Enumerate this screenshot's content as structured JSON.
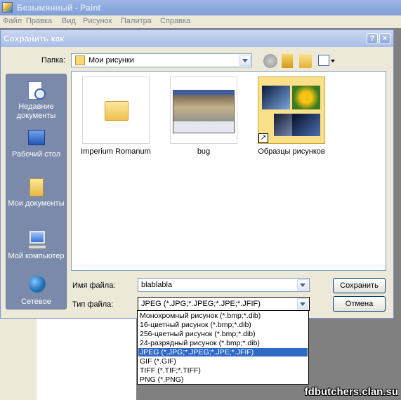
{
  "paint": {
    "title": "Безымянный - Paint",
    "menu": [
      "Файл",
      "Правка",
      "Вид",
      "Рисунок",
      "Палитра",
      "Справка"
    ]
  },
  "dialog": {
    "title": "Сохранить как",
    "help_btn": "?",
    "close_btn": "×",
    "folder_label": "Папка:",
    "folder_value": "Мои рисунки",
    "places": [
      {
        "label": "Недавние документы",
        "icon": "recent-documents-icon"
      },
      {
        "label": "Рабочий стол",
        "icon": "desktop-icon"
      },
      {
        "label": "Мои документы",
        "icon": "my-documents-icon"
      },
      {
        "label": "Мой компьютер",
        "icon": "my-computer-icon"
      },
      {
        "label": "Сетевое",
        "icon": "network-icon"
      }
    ],
    "files": [
      {
        "name": "Imperium Romanum",
        "type": "folder"
      },
      {
        "name": "bug",
        "type": "image"
      },
      {
        "name": "Образцы рисунков",
        "type": "shortcut-folder"
      }
    ],
    "filename_label": "Имя файла:",
    "filename_value": "blablabla",
    "filetype_label": "Тип файла:",
    "filetype_value": "JPEG (*.JPG;*.JPEG;*.JPE;*.JFIF)",
    "save_button": "Сохранить",
    "cancel_button": "Отмена",
    "filetype_options": [
      "Монохромный рисунок (*.bmp;*.dib)",
      "16-цветный рисунок (*.bmp;*.dib)",
      "256-цветный рисунок (*.bmp;*.dib)",
      "24-разрядный рисунок (*.bmp;*.dib)",
      "JPEG (*.JPG;*.JPEG;*.JPE;*.JFIF)",
      "GIF (*.GIF)",
      "TIFF (*.TIF;*.TIFF)",
      "PNG (*.PNG)"
    ],
    "selected_option_index": 4
  },
  "watermark": "fdbutchers.clan.su",
  "colors": {
    "accent": "#316ac5",
    "places_bg": "#7b8aab",
    "dialog_bg": "#ece9d8"
  }
}
